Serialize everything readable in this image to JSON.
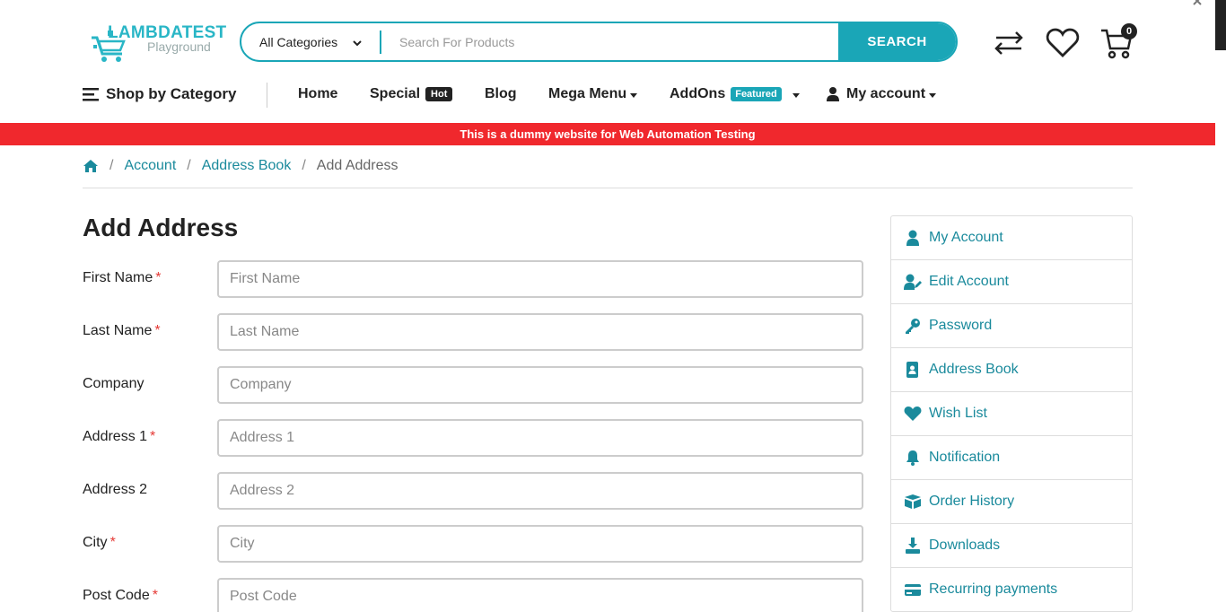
{
  "logo": {
    "title": "LAMBDATEST",
    "subtitle": "Playground"
  },
  "search": {
    "category": "All Categories",
    "placeholder": "Search For Products",
    "button": "SEARCH"
  },
  "cart": {
    "count": "0"
  },
  "nav": {
    "shop_by_category": "Shop by Category",
    "home": "Home",
    "special": "Special",
    "special_badge": "Hot",
    "blog": "Blog",
    "mega_menu": "Mega Menu",
    "addons": "AddOns",
    "addons_badge": "Featured",
    "my_account": "My account"
  },
  "banner": "This is a dummy website for Web Automation Testing",
  "breadcrumb": {
    "account": "Account",
    "address_book": "Address Book",
    "current": "Add Address"
  },
  "page_title": "Add Address",
  "form": {
    "fields": [
      {
        "label": "First Name",
        "placeholder": "First Name",
        "required": true
      },
      {
        "label": "Last Name",
        "placeholder": "Last Name",
        "required": true
      },
      {
        "label": "Company",
        "placeholder": "Company",
        "required": false
      },
      {
        "label": "Address 1",
        "placeholder": "Address 1",
        "required": true
      },
      {
        "label": "Address 2",
        "placeholder": "Address 2",
        "required": false
      },
      {
        "label": "City",
        "placeholder": "City",
        "required": true
      },
      {
        "label": "Post Code",
        "placeholder": "Post Code",
        "required": true
      }
    ],
    "required_mark": "*"
  },
  "sidebar": {
    "items": [
      {
        "label": "My Account",
        "icon": "user-icon"
      },
      {
        "label": "Edit Account",
        "icon": "user-edit-icon"
      },
      {
        "label": "Password",
        "icon": "key-icon"
      },
      {
        "label": "Address Book",
        "icon": "address-book-icon"
      },
      {
        "label": "Wish List",
        "icon": "heart-icon"
      },
      {
        "label": "Notification",
        "icon": "bell-icon"
      },
      {
        "label": "Order History",
        "icon": "box-icon"
      },
      {
        "label": "Downloads",
        "icon": "download-icon"
      },
      {
        "label": "Recurring payments",
        "icon": "credit-card-icon"
      }
    ]
  },
  "colors": {
    "accent": "#1aa6b7",
    "link": "#1a8a9c",
    "banner": "#f0282d",
    "required": "#e53935"
  }
}
